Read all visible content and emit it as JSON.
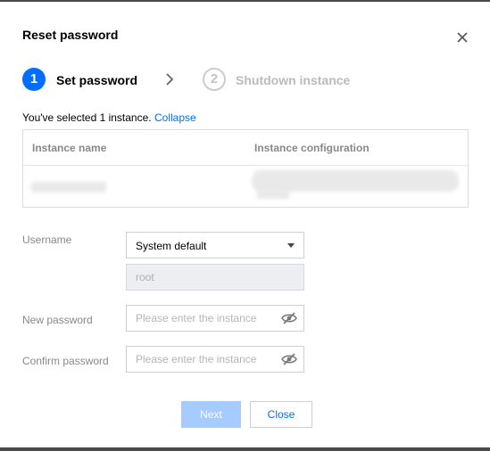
{
  "dialog": {
    "title": "Reset password"
  },
  "steps": [
    {
      "number": "1",
      "label": "Set password",
      "state": "active"
    },
    {
      "number": "2",
      "label": "Shutdown instance",
      "state": "inactive"
    }
  ],
  "selection": {
    "text": "You've selected 1 instance.",
    "collapse_link": "Collapse"
  },
  "table": {
    "headers": [
      "Instance name",
      "Instance configuration"
    ]
  },
  "form": {
    "username_label": "Username",
    "username_select": "System default",
    "username_value": "root",
    "new_password_label": "New password",
    "new_password_placeholder": "Please enter the instance",
    "confirm_password_label": "Confirm password",
    "confirm_password_placeholder": "Please enter the instance"
  },
  "buttons": {
    "next": "Next",
    "close": "Close"
  },
  "icons": {
    "close": "close-icon",
    "chevron": "chevron-right-icon",
    "eye": "eye-off-icon"
  },
  "colors": {
    "primary": "#006eff",
    "primary_disabled": "#a6cbff",
    "label_gray": "#888888"
  }
}
